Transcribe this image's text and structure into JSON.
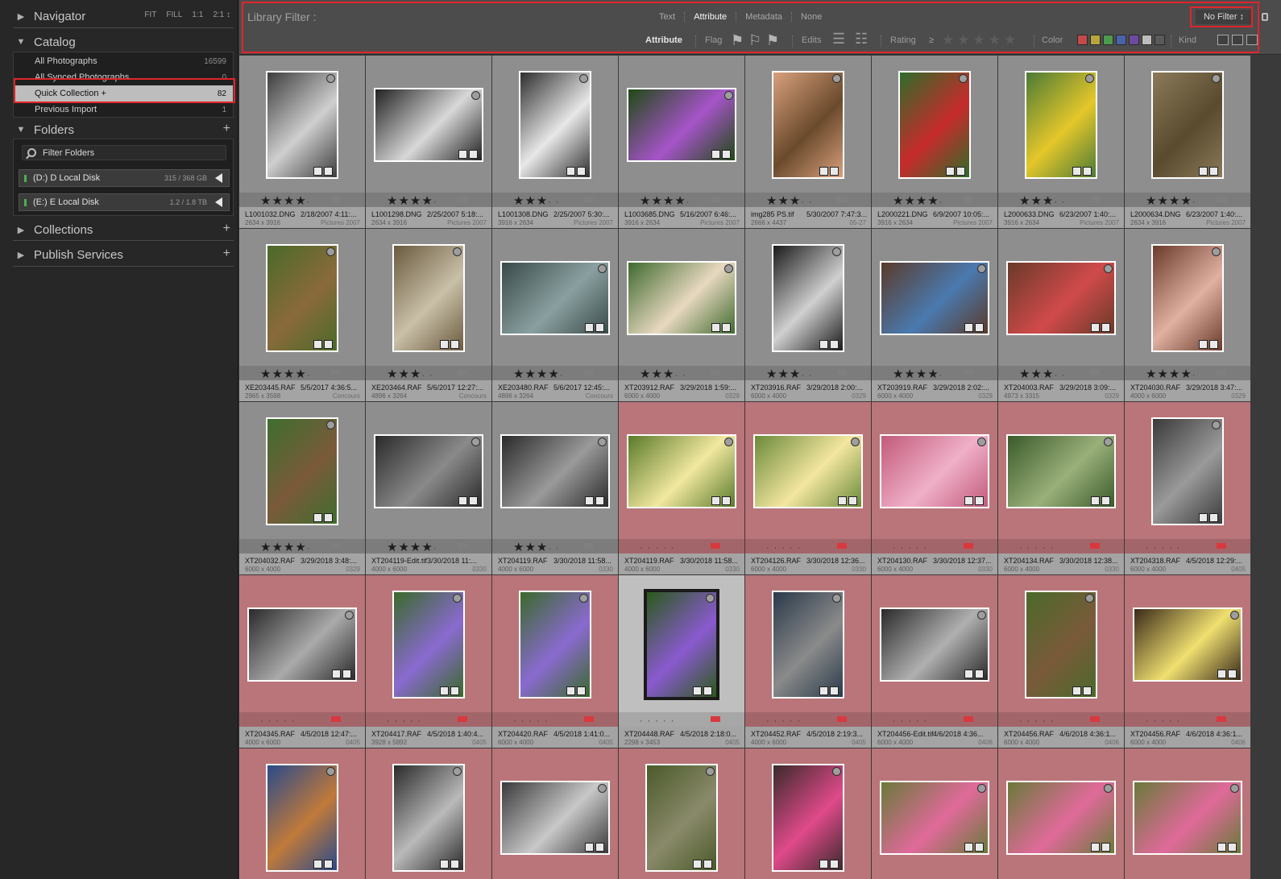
{
  "navigator": {
    "title": "Navigator",
    "zoom_options": [
      "FIT",
      "FILL",
      "1:1",
      "2:1 ↕"
    ]
  },
  "catalog": {
    "title": "Catalog",
    "items": [
      {
        "label": "All Photographs",
        "count": "16599"
      },
      {
        "label": "All Synced Photographs",
        "count": "0"
      },
      {
        "label": "Quick Collection +",
        "count": "82"
      },
      {
        "label": "Previous Import",
        "count": "1"
      }
    ]
  },
  "folders": {
    "title": "Folders",
    "filter_placeholder": "Filter Folders",
    "volumes": [
      {
        "label": "(D:) D Local Disk",
        "size": "315 / 368 GB"
      },
      {
        "label": "(E:) E Local Disk",
        "size": "1.2 / 1.8 TB"
      }
    ]
  },
  "collections": {
    "title": "Collections"
  },
  "publish": {
    "title": "Publish Services"
  },
  "filter_bar": {
    "title": "Library Filter :",
    "tabs": [
      "Text",
      "Attribute",
      "Metadata",
      "None"
    ],
    "preset": "No Filter ↕",
    "attribute_label": "Attribute",
    "flag_label": "Flag",
    "edits_label": "Edits",
    "rating_label": "Rating",
    "rating_op": "≥",
    "color_label": "Color",
    "kind_label": "Kind",
    "color_swatches": [
      "#c24a4a",
      "#b5a53c",
      "#4c9a4c",
      "#4a62a8",
      "#6d4aa0",
      "#bdbdbd",
      "#5a5a5a"
    ]
  },
  "photos": [
    {
      "name": "L1001032.DNG",
      "date": "2/18/2007 4:11:...",
      "dims": "2634 x 3916",
      "extra": "Pictures 2007",
      "stars": 4,
      "color": "none",
      "orient": "portrait",
      "swatch": [
        "#3d3d3d",
        "#cfcfcf"
      ]
    },
    {
      "name": "L1001298.DNG",
      "date": "2/25/2007 5:18:...",
      "dims": "2634 x 3916",
      "extra": "Pictures 2007",
      "stars": 4,
      "color": "none",
      "orient": "landscape",
      "swatch": [
        "#222222",
        "#d8d8d8"
      ]
    },
    {
      "name": "L1001308.DNG",
      "date": "2/25/2007 5:30:...",
      "dims": "3916 x 2634",
      "extra": "Pictures 2007",
      "stars": 3,
      "color": "none",
      "orient": "portrait",
      "swatch": [
        "#2f2f2f",
        "#e8e8e8"
      ]
    },
    {
      "name": "L1003685.DNG",
      "date": "5/16/2007 6:46:...",
      "dims": "3916 x 2634",
      "extra": "Pictures 2007",
      "stars": 4,
      "color": "none",
      "orient": "landscape",
      "swatch": [
        "#1f4a14",
        "#a654c9"
      ]
    },
    {
      "name": "img285 PS.tif",
      "date": "5/30/2007 7:47:3...",
      "dims": "2666 x 4437",
      "extra": "05-27",
      "stars": 3,
      "color": "none",
      "orient": "portrait",
      "swatch": [
        "#d8a07c",
        "#6a4a2c"
      ]
    },
    {
      "name": "L2000221.DNG",
      "date": "6/9/2007 10:05:...",
      "dims": "3916 x 2634",
      "extra": "Pictures 2007",
      "stars": 4,
      "color": "none",
      "orient": "portrait",
      "swatch": [
        "#2e6c2a",
        "#c72b2b"
      ]
    },
    {
      "name": "L2000633.DNG",
      "date": "6/23/2007 1:40:...",
      "dims": "3916 x 2634",
      "extra": "Pictures 2007",
      "stars": 3,
      "color": "none",
      "orient": "portrait",
      "swatch": [
        "#4b7a35",
        "#e5c72a"
      ]
    },
    {
      "name": "L2000634.DNG",
      "date": "6/23/2007 1:40:...",
      "dims": "2634 x 3916",
      "extra": "Pictures 2007",
      "stars": 4,
      "color": "none",
      "orient": "portrait",
      "swatch": [
        "#8a7a5a",
        "#5a4a2e"
      ]
    },
    {
      "name": "XE203445.RAF",
      "date": "5/5/2017 4:36:5...",
      "dims": "2965 x 3598",
      "extra": "Concours",
      "stars": 4,
      "color": "none",
      "orient": "portrait",
      "swatch": [
        "#4a6a2a",
        "#8a6a3a"
      ]
    },
    {
      "name": "XE203464.RAF",
      "date": "5/6/2017 12:27:...",
      "dims": "4896 x 3264",
      "extra": "Concours",
      "stars": 3,
      "color": "none",
      "orient": "portrait",
      "swatch": [
        "#6a5a3e",
        "#c9c0a8"
      ]
    },
    {
      "name": "XE203480.RAF",
      "date": "5/6/2017 12:45:...",
      "dims": "4896 x 3264",
      "extra": "Concours",
      "stars": 4,
      "color": "none",
      "orient": "landscape",
      "swatch": [
        "#3a4a4a",
        "#8aa0a0"
      ]
    },
    {
      "name": "XT203912.RAF",
      "date": "3/29/2018 1:59:...",
      "dims": "6000 x 4000",
      "extra": "0329",
      "stars": 3,
      "color": "none",
      "orient": "landscape",
      "swatch": [
        "#3f6a2e",
        "#e8d8c0"
      ]
    },
    {
      "name": "XT203916.RAF",
      "date": "3/29/2018 2:00:...",
      "dims": "6000 x 4000",
      "extra": "0329",
      "stars": 3,
      "color": "none",
      "orient": "portrait",
      "swatch": [
        "#1a1a1a",
        "#d0d0d0"
      ]
    },
    {
      "name": "XT203919.RAF",
      "date": "3/29/2018 2:02:...",
      "dims": "6000 x 4000",
      "extra": "0329",
      "stars": 4,
      "color": "none",
      "orient": "landscape",
      "swatch": [
        "#5a3a2a",
        "#4a7ab0"
      ]
    },
    {
      "name": "XT204003.RAF",
      "date": "3/29/2018 3:09:...",
      "dims": "4973 x 3315",
      "extra": "0329",
      "stars": 3,
      "color": "none",
      "orient": "landscape",
      "swatch": [
        "#6a3a2a",
        "#d04a4a"
      ]
    },
    {
      "name": "XT204030.RAF",
      "date": "3/29/2018 3:47:...",
      "dims": "4000 x 6000",
      "extra": "0329",
      "stars": 4,
      "color": "none",
      "orient": "portrait",
      "swatch": [
        "#6a3a2a",
        "#e0b0a0"
      ]
    },
    {
      "name": "XT204032.RAF",
      "date": "3/29/2018 3:48:...",
      "dims": "6000 x 4000",
      "extra": "0329",
      "stars": 4,
      "color": "none",
      "orient": "portrait",
      "swatch": [
        "#3e6e2e",
        "#7a5a3a"
      ]
    },
    {
      "name": "XT204119-Edit.tif",
      "date": "3/30/2018 11:...",
      "dims": "4000 x 6000",
      "extra": "0330",
      "stars": 4,
      "color": "none",
      "orient": "landscape",
      "swatch": [
        "#2a2a2a",
        "#8a8a8a"
      ]
    },
    {
      "name": "XT204119.RAF",
      "date": "3/30/2018 11:58...",
      "dims": "4000 x 6000",
      "extra": "0330",
      "stars": 3,
      "color": "none",
      "orient": "landscape",
      "swatch": [
        "#2a2a2a",
        "#9a9a9a"
      ]
    },
    {
      "name": "XT204119.RAF",
      "date": "3/30/2018 11:58...",
      "dims": "4000 x 6000",
      "extra": "0330",
      "stars": 0,
      "color": "red",
      "orient": "landscape",
      "swatch": [
        "#5a7a2a",
        "#f2e8a0"
      ]
    },
    {
      "name": "XT204126.RAF",
      "date": "3/30/2018 12:36...",
      "dims": "6000 x 4000",
      "extra": "0330",
      "stars": 0,
      "color": "red",
      "orient": "landscape",
      "swatch": [
        "#6a8a3a",
        "#f4e6a0"
      ]
    },
    {
      "name": "XT204130.RAF",
      "date": "3/30/2018 12:37...",
      "dims": "6000 x 4000",
      "extra": "0330",
      "stars": 0,
      "color": "red",
      "orient": "landscape",
      "swatch": [
        "#c25a7a",
        "#f0b0c8"
      ]
    },
    {
      "name": "XT204134.RAF",
      "date": "3/30/2018 12:38...",
      "dims": "6000 x 4000",
      "extra": "0330",
      "stars": 0,
      "color": "red",
      "orient": "landscape",
      "swatch": [
        "#3a5a2a",
        "#9ab07a"
      ]
    },
    {
      "name": "XT204318.RAF",
      "date": "4/5/2018 12:29:...",
      "dims": "6000 x 4000",
      "extra": "0405",
      "stars": 0,
      "color": "red",
      "orient": "portrait",
      "swatch": [
        "#3a3a3a",
        "#9a9a9a"
      ]
    },
    {
      "name": "XT204345.RAF",
      "date": "4/5/2018 12:47:...",
      "dims": "4000 x 6000",
      "extra": "0405",
      "stars": 0,
      "color": "red",
      "orient": "landscape",
      "swatch": [
        "#2a2a2a",
        "#aaaaaa"
      ]
    },
    {
      "name": "XT204417.RAF",
      "date": "4/5/2018 1:40:4...",
      "dims": "3928 x 5892",
      "extra": "0405",
      "stars": 0,
      "color": "red",
      "orient": "portrait",
      "swatch": [
        "#3a6a2a",
        "#8a6ad0"
      ]
    },
    {
      "name": "XT204420.RAF",
      "date": "4/5/2018 1:41:0...",
      "dims": "6000 x 4000",
      "extra": "0405",
      "stars": 0,
      "color": "red",
      "orient": "portrait",
      "swatch": [
        "#3a6a2a",
        "#8a6ad0"
      ]
    },
    {
      "name": "XT204448.RAF",
      "date": "4/5/2018 2:18:0...",
      "dims": "2298 x 3453",
      "extra": "0405",
      "stars": 0,
      "color": "red",
      "orient": "portrait",
      "swatch": [
        "#2a5a1a",
        "#8a5ad0"
      ],
      "selected": true
    },
    {
      "name": "XT204452.RAF",
      "date": "4/5/2018 2:19:3...",
      "dims": "4000 x 6000",
      "extra": "0405",
      "stars": 0,
      "color": "red",
      "orient": "portrait",
      "swatch": [
        "#2a3a4a",
        "#8a8a8a"
      ]
    },
    {
      "name": "XT204456-Edit.tif",
      "date": "4/6/2018 4:36...",
      "dims": "6000 x 4000",
      "extra": "0406",
      "stars": 0,
      "color": "red",
      "orient": "landscape",
      "swatch": [
        "#2a2a2a",
        "#b0b0b0"
      ]
    },
    {
      "name": "XT204456.RAF",
      "date": "4/6/2018 4:36:1...",
      "dims": "6000 x 4000",
      "extra": "0406",
      "stars": 0,
      "color": "red",
      "orient": "portrait",
      "swatch": [
        "#4a6a2a",
        "#7a5a3a"
      ]
    },
    {
      "name": "XT204456.RAF",
      "date": "4/6/2018 4:36:1...",
      "dims": "6000 x 4000",
      "extra": "0406",
      "stars": 0,
      "color": "red",
      "orient": "landscape",
      "swatch": [
        "#3a2a1a",
        "#f0e070"
      ]
    },
    {
      "name": "",
      "date": "",
      "dims": "",
      "extra": "",
      "stars": 0,
      "color": "red",
      "orient": "portrait",
      "swatch": [
        "#2a4a8a",
        "#c07a3a"
      ]
    },
    {
      "name": "",
      "date": "",
      "dims": "",
      "extra": "",
      "stars": 0,
      "color": "red",
      "orient": "portrait",
      "swatch": [
        "#2a2a2a",
        "#bababa"
      ]
    },
    {
      "name": "",
      "date": "",
      "dims": "",
      "extra": "",
      "stars": 0,
      "color": "red",
      "orient": "landscape",
      "swatch": [
        "#3a3a3a",
        "#c8c8c8"
      ]
    },
    {
      "name": "",
      "date": "",
      "dims": "",
      "extra": "",
      "stars": 0,
      "color": "red",
      "orient": "portrait",
      "swatch": [
        "#4a5a2a",
        "#8a8a6a"
      ]
    },
    {
      "name": "",
      "date": "",
      "dims": "",
      "extra": "",
      "stars": 0,
      "color": "red",
      "orient": "portrait",
      "swatch": [
        "#3a2a2a",
        "#e04a8a"
      ]
    },
    {
      "name": "",
      "date": "",
      "dims": "",
      "extra": "",
      "stars": 0,
      "color": "red",
      "orient": "landscape",
      "swatch": [
        "#6a7a3a",
        "#e06a9a"
      ]
    },
    {
      "name": "",
      "date": "",
      "dims": "",
      "extra": "",
      "stars": 0,
      "color": "red",
      "orient": "landscape",
      "swatch": [
        "#6a7a3a",
        "#e06a9a"
      ]
    },
    {
      "name": "",
      "date": "",
      "dims": "",
      "extra": "",
      "stars": 0,
      "color": "red",
      "orient": "landscape",
      "swatch": [
        "#6a7a3a",
        "#e06a9a"
      ]
    }
  ]
}
